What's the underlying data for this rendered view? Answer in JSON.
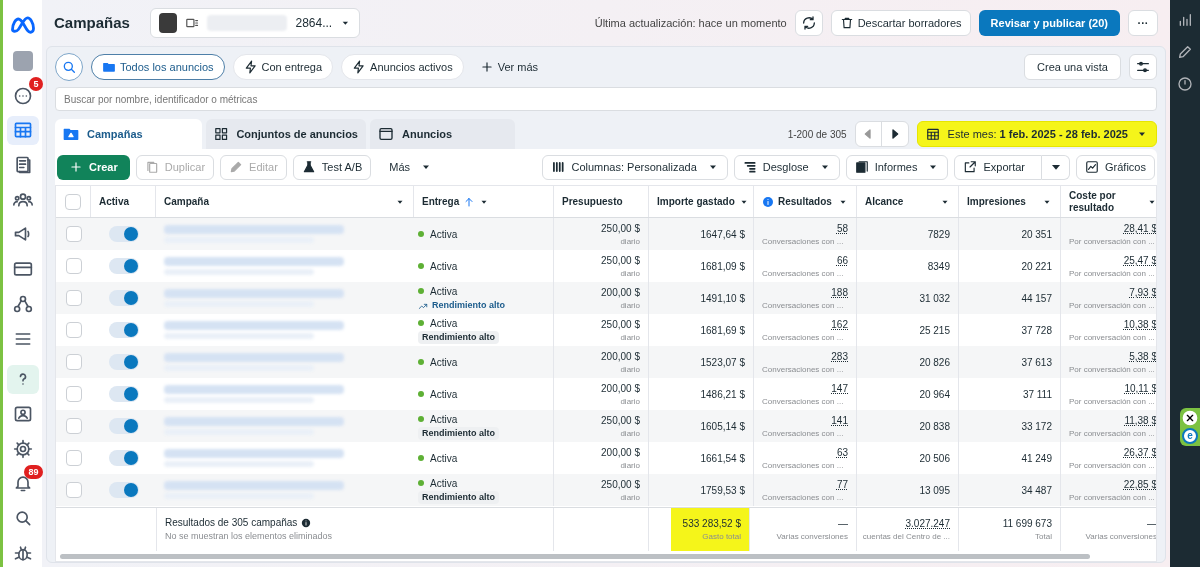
{
  "header": {
    "title": "Campañas",
    "account": {
      "id_fragment": "2864..."
    },
    "last_update": "Última actualización: hace un momento",
    "discard": "Descartar borradores",
    "publish": "Revisar y publicar (20)",
    "more": "···"
  },
  "sidebar": {
    "top": [
      {
        "selected": false
      },
      {
        "selected": false
      },
      {
        "selected": false,
        "badge": "5"
      },
      {
        "selected": true
      },
      {
        "selected": false
      },
      {
        "selected": false
      },
      {
        "selected": false
      },
      {
        "selected": false
      },
      {
        "selected": false
      },
      {
        "selected": false
      }
    ],
    "bottom": [
      {
        "selected": true
      },
      {
        "selected": false
      },
      {
        "selected": false
      },
      {
        "selected": false,
        "badge": "89"
      },
      {
        "selected": false
      },
      {
        "selected": false
      }
    ]
  },
  "filters": [
    {
      "label": "Todos los anuncios",
      "selected": true
    },
    {
      "label": "Con entrega",
      "selected": false
    },
    {
      "label": "Anuncios activos",
      "selected": false
    }
  ],
  "see_more": "Ver más",
  "create_view": "Crea una vista",
  "search": {
    "placeholder": "Buscar por nombre, identificador o métricas"
  },
  "tabs": [
    {
      "label": "Campañas",
      "selected": true
    },
    {
      "label": "Conjuntos de anuncios",
      "selected": false
    },
    {
      "label": "Anuncios",
      "selected": false
    }
  ],
  "pagination": "1-200 de 305",
  "date_range": {
    "prefix": "Este mes: ",
    "range": "1 feb. 2025 - 28 feb. 2025",
    "highlighted": true
  },
  "toolbar": {
    "create": "Crear",
    "duplicate": "Duplicar",
    "edit": "Editar",
    "ab_test": "Test A/B",
    "more": "Más",
    "columns": "Columnas: Personalizada",
    "breakdown": "Desglose",
    "reports": "Informes",
    "export": "Exportar",
    "charts": "Gráficos"
  },
  "table": {
    "select_all_checked": false,
    "columns": [
      "Activa",
      "Campaña",
      "Entrega",
      "Presupuesto",
      "Importe gastado",
      "Resultados",
      "Alcance",
      "Impresiones",
      "Coste por resultado"
    ],
    "rows": [
      {
        "checked": false,
        "on": true,
        "status": "Activa",
        "budget": "250,00 $",
        "budget_note": "diario",
        "spent": "1647,64 $",
        "results": "58",
        "results_note": "Conversaciones con ...",
        "reach": "7829",
        "impressions": "20 351",
        "cost": "28,41 $",
        "cost_note": "Por conversación con ..."
      },
      {
        "checked": false,
        "on": true,
        "status": "Activa",
        "budget": "250,00 $",
        "budget_note": "diario",
        "spent": "1681,09 $",
        "results": "66",
        "results_note": "Conversaciones con ...",
        "reach": "8349",
        "impressions": "20 221",
        "cost": "25,47 $",
        "cost_note": "Por conversación con ..."
      },
      {
        "checked": false,
        "on": true,
        "status": "Activa",
        "badge": {
          "kind": "trend",
          "text": "Rendimiento alto"
        },
        "budget": "200,00 $",
        "budget_note": "diario",
        "spent": "1491,10 $",
        "results": "188",
        "results_note": "Conversaciones con ...",
        "reach": "31 032",
        "impressions": "44 157",
        "cost": "7,93 $",
        "cost_note": "Por conversación con ..."
      },
      {
        "checked": false,
        "on": true,
        "status": "Activa",
        "badge": {
          "kind": "plain",
          "text": "Rendimiento alto"
        },
        "budget": "250,00 $",
        "budget_note": "diario",
        "spent": "1681,69 $",
        "results": "162",
        "results_note": "Conversaciones con ...",
        "reach": "25 215",
        "impressions": "37 728",
        "cost": "10,38 $",
        "cost_note": "Por conversación con ..."
      },
      {
        "checked": false,
        "on": true,
        "status": "Activa",
        "budget": "200,00 $",
        "budget_note": "diario",
        "spent": "1523,07 $",
        "results": "283",
        "results_note": "Conversaciones con ...",
        "reach": "20 826",
        "impressions": "37 613",
        "cost": "5,38 $",
        "cost_note": "Por conversación con ..."
      },
      {
        "checked": false,
        "on": true,
        "status": "Activa",
        "budget": "200,00 $",
        "budget_note": "diario",
        "spent": "1486,21 $",
        "results": "147",
        "results_note": "Conversaciones con ...",
        "reach": "20 964",
        "impressions": "37 111",
        "cost": "10,11 $",
        "cost_note": "Por conversación con ..."
      },
      {
        "checked": false,
        "on": true,
        "status": "Activa",
        "badge": {
          "kind": "plain",
          "text": "Rendimiento alto"
        },
        "budget": "250,00 $",
        "budget_note": "diario",
        "spent": "1605,14 $",
        "results": "141",
        "results_note": "Conversaciones con ...",
        "reach": "20 838",
        "impressions": "33 172",
        "cost": "11,38 $",
        "cost_note": "Por conversación con ..."
      },
      {
        "checked": false,
        "on": true,
        "status": "Activa",
        "budget": "200,00 $",
        "budget_note": "diario",
        "spent": "1661,54 $",
        "results": "63",
        "results_note": "Conversaciones con ...",
        "reach": "20 506",
        "impressions": "41 249",
        "cost": "26,37 $",
        "cost_note": "Por conversación con ..."
      },
      {
        "checked": false,
        "on": true,
        "status": "Activa",
        "badge": {
          "kind": "plain",
          "text": "Rendimiento alto"
        },
        "budget": "250,00 $",
        "budget_note": "diario",
        "spent": "1759,53 $",
        "results": "77",
        "results_note": "Conversaciones con ...",
        "reach": "13 095",
        "impressions": "34 487",
        "cost": "22,85 $",
        "cost_note": "Por conversación con ..."
      }
    ],
    "footer": {
      "title": "Resultados de 305 campañas",
      "note": "No se muestran los elementos eliminados",
      "cells": [
        {
          "value": "533 283,52 $",
          "label": "Gasto total",
          "highlighted": true
        },
        {
          "value": "—",
          "label": "Varias conversiones"
        },
        {
          "value": "3.027.247",
          "label": "cuentas del Centro de ..."
        },
        {
          "value": "11 699 673",
          "label": "Total"
        },
        {
          "value": "—",
          "label": "Varias conversiones"
        }
      ]
    }
  },
  "extension": {
    "label": "e"
  }
}
